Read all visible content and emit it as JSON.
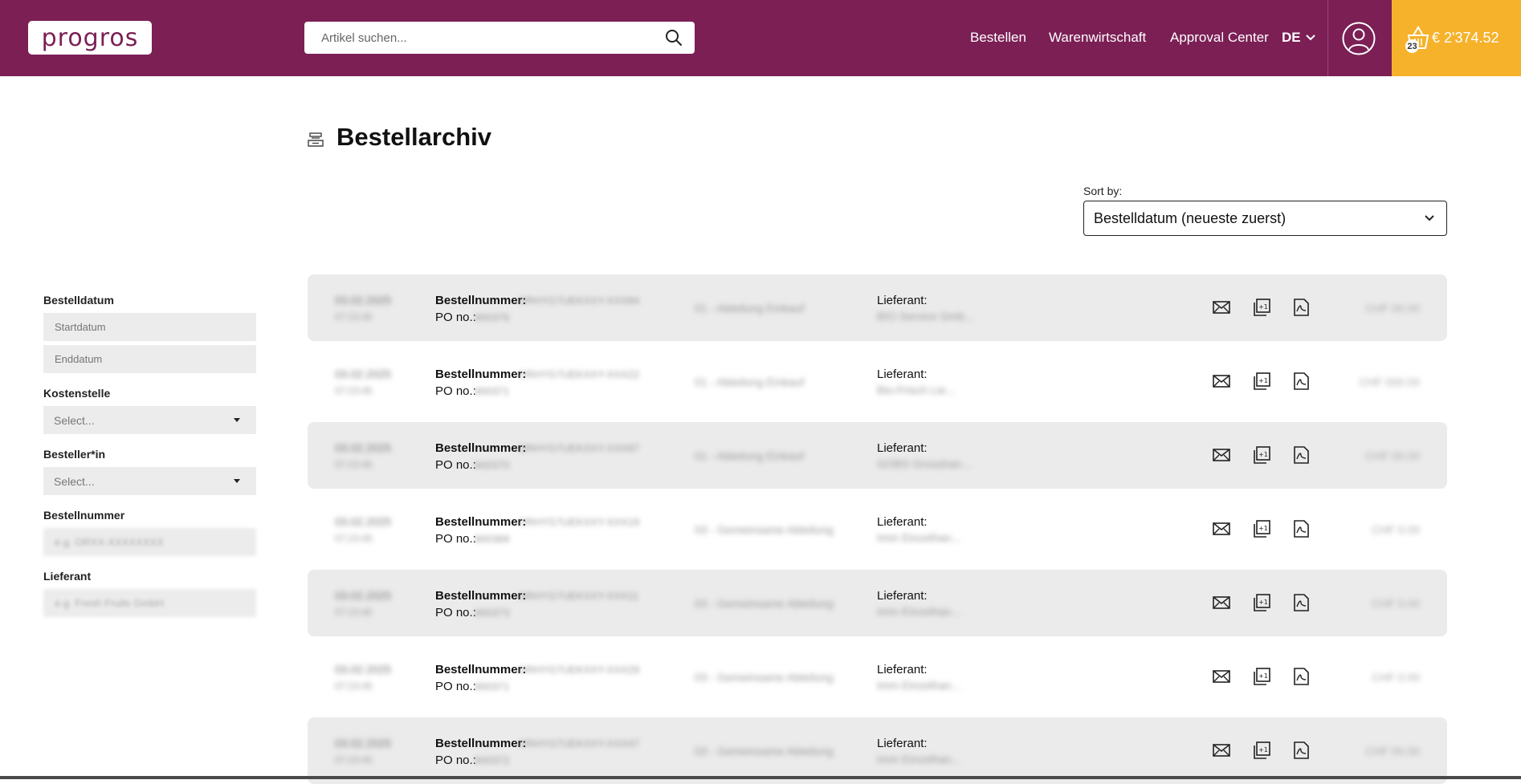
{
  "header": {
    "logo_text": "progros",
    "search_placeholder": "Artikel suchen...",
    "nav": [
      "Bestellen",
      "Warenwirtschaft",
      "Approval Center"
    ],
    "language": "DE",
    "cart_count": "23",
    "cart_total": "€ 2'374.52",
    "colors": {
      "brand": "#7b1f55",
      "cart": "#f6b22b"
    }
  },
  "page": {
    "title": "Bestellarchiv",
    "sort_label": "Sort by:",
    "sort_value": "Bestelldatum (neueste zuerst)"
  },
  "filters": {
    "date_label": "Bestelldatum",
    "start_placeholder": "Startdatum",
    "end_placeholder": "Enddatum",
    "cost_center_label": "Kostenstelle",
    "cost_center_value": "Select...",
    "orderer_label": "Besteller*in",
    "orderer_value": "Select...",
    "order_number_label": "Bestellnummer",
    "order_number_placeholder": "e.g. ORXX-XXXXXXXX",
    "supplier_label": "Lieferant",
    "supplier_placeholder": "e.g. Fresh Fruits GmbH"
  },
  "orders": {
    "order_number_label": "Bestellnummer:",
    "po_label": "PO no.:",
    "supplier_label": "Lieferant:",
    "rows": [
      {
        "date": "03.02.2025",
        "time": "07:23:45",
        "order_no": "ORHYG7UEKXXY-XXX84",
        "po": "900376",
        "cost_center": "01 - Abteilung Einkauf",
        "supplier": "BIO Service Gmb...",
        "amount": "CHF 00.00"
      },
      {
        "date": "03.02.2025",
        "time": "07:23:45",
        "order_no": "ORHYG7UEKXXY-XXX22",
        "po": "900371",
        "cost_center": "01 - Abteilung Einkauf",
        "supplier": "Bio-Frisch Lie...",
        "amount": "CHF 000.00"
      },
      {
        "date": "03.02.2025",
        "time": "07:23:45",
        "order_no": "ORHYG7UEKXXY-XXX97",
        "po": "900370",
        "cost_center": "01 - Abteilung Einkauf",
        "supplier": "GOBS Grosshan...",
        "amount": "CHF 00.00"
      },
      {
        "date": "03.02.2025",
        "time": "07:23:45",
        "order_no": "ORHYG7UEKXXY-XXX19",
        "po": "900369",
        "cost_center": "03 - Gemeinsame Abteilung",
        "supplier": "Imm Einzelhan...",
        "amount": "CHF 0.00"
      },
      {
        "date": "03.02.2025",
        "time": "07:23:45",
        "order_no": "ORHYG7UEKXXY-XXX11",
        "po": "900373",
        "cost_center": "03 - Gemeinsame Abteilung",
        "supplier": "Imm Einzelhan...",
        "amount": "CHF 0.00"
      },
      {
        "date": "03.02.2025",
        "time": "07:23:45",
        "order_no": "ORHYG7UEKXXY-XXX29",
        "po": "900371",
        "cost_center": "03 - Gemeinsame Abteilung",
        "supplier": "Imm Einzelhan...",
        "amount": "CHF 0.00"
      },
      {
        "date": "03.02.2025",
        "time": "07:23:45",
        "order_no": "ORHYG7UEKXXY-XXX47",
        "po": "900372",
        "cost_center": "03 - Gemeinsame Abteilung",
        "supplier": "Imm Einzelhan...",
        "amount": "CHF 00.00"
      }
    ]
  }
}
